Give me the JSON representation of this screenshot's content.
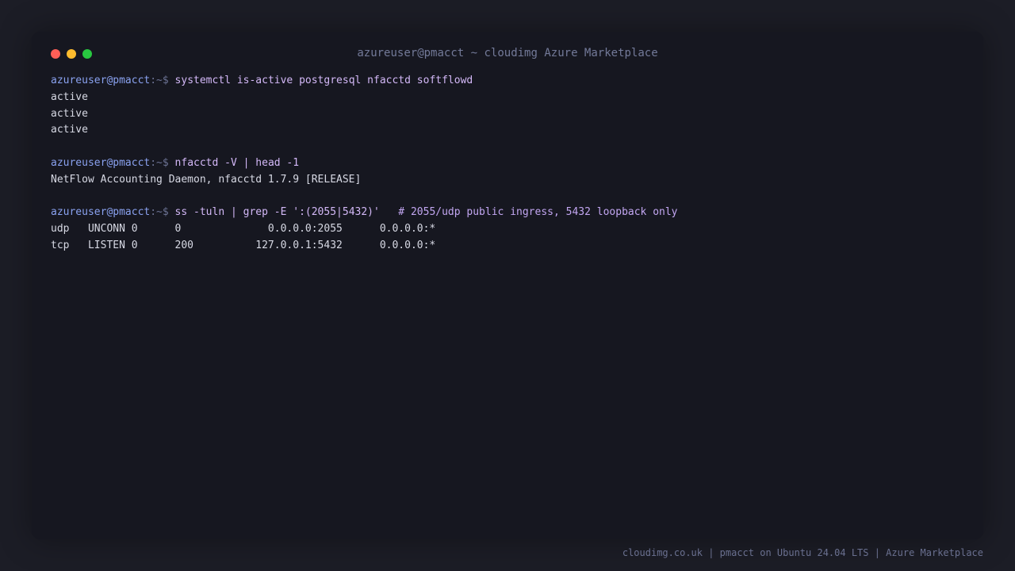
{
  "window": {
    "title": "azureuser@pmacct ~ cloudimg Azure Marketplace"
  },
  "prompt": {
    "user_host": "azureuser@pmacct",
    "path_sign": ":~$ "
  },
  "terminal": {
    "cmd1": "systemctl is-active postgresql nfacctd softflowd",
    "out1": [
      "active",
      "active",
      "active"
    ],
    "cmd2": "nfacctd -V | head -1",
    "out2": "NetFlow Accounting Daemon, nfacctd 1.7.9 [RELEASE]",
    "cmd3": "ss -tuln | grep -E ':(2055|5432)'",
    "cmd3_comment": "   # 2055/udp public ingress, 5432 loopback only",
    "out3": [
      "udp   UNCONN 0      0              0.0.0.0:2055      0.0.0.0:*",
      "tcp   LISTEN 0      200          127.0.0.1:5432      0.0.0.0:*"
    ]
  },
  "footer": {
    "text": "cloudimg.co.uk | pmacct on Ubuntu 24.04 LTS | Azure Marketplace"
  },
  "colors": {
    "background": "#1c1d26",
    "window": "#161720",
    "prompt": "#8aa2f0",
    "command": "#d3b8f7",
    "output": "#d7d9e4"
  }
}
